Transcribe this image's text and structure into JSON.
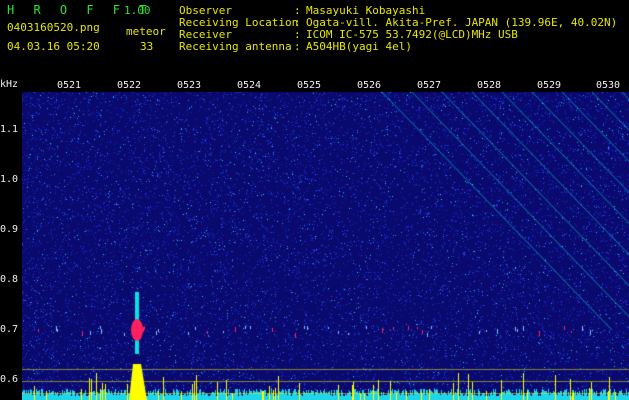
{
  "header": {
    "app_title": "H R O F F T",
    "app_version": "1.00",
    "file_name": "0403160520.png",
    "meteor_label": "meteor",
    "date_time": "04.03.16 05:20",
    "meteor_count": "33",
    "info": [
      {
        "label": "Observer",
        "value": "Masayuki Kobayashi"
      },
      {
        "label": "Receiving Location",
        "value": "Ogata-vill. Akita-Pref. JAPAN (139.96E, 40.02N)"
      },
      {
        "label": "Receiver",
        "value": "ICOM IC-575 53.7492(@LCD)MHz USB"
      },
      {
        "label": "Receiving antenna",
        "value": "A504HB(yagi 4el)"
      }
    ]
  },
  "spectrogram": {
    "y_unit": "kHz",
    "y_ticks": [
      "1.1",
      "1.0",
      "0.9",
      "0.8",
      "0.7",
      "0.6"
    ],
    "time_ticks": [
      "0521",
      "0522",
      "0523",
      "0524",
      "0525",
      "0526",
      "0527",
      "0528",
      "0529",
      "0530"
    ],
    "colors": {
      "background": "#0a0a6e",
      "noise": "#1e3cff",
      "echo": "#00e5e5",
      "strong": "#ff2060",
      "signal": "#ffff00"
    }
  }
}
